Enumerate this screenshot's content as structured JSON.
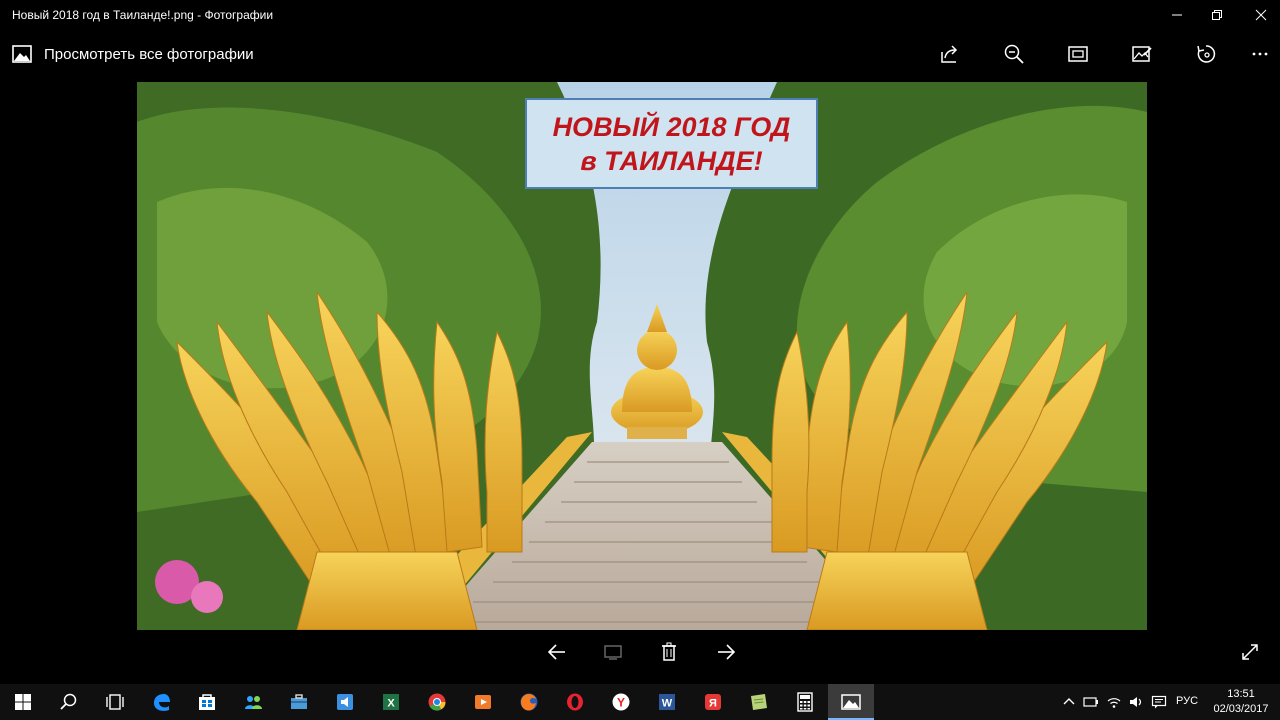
{
  "window": {
    "title": "Новый 2018 год в Таиланде!.png - Фотографии"
  },
  "appbar": {
    "view_all_label": "Просмотреть все фотографии"
  },
  "photo": {
    "caption_line1": "НОВЫЙ 2018  ГОД",
    "caption_line2": "в ТАИЛАНДЕ!",
    "caption_color": "#c0161b",
    "caption_bg": "#cfe3f0"
  },
  "icons": {
    "toolbar": [
      "share-icon",
      "zoom-out-icon",
      "slideshow-icon",
      "edit-icon",
      "rotate-icon",
      "more-icon"
    ],
    "nav": [
      "arrow-left-icon",
      "cast-icon",
      "delete-icon",
      "arrow-right-icon",
      "fullscreen-icon"
    ]
  },
  "taskbar": {
    "language": "РУС",
    "time": "13:51",
    "date": "02/03/2017",
    "apps": [
      "start",
      "search",
      "task-view",
      "edge",
      "store",
      "people",
      "briefcase",
      "audio",
      "excel",
      "chrome",
      "media-player",
      "firefox",
      "opera",
      "yandex",
      "word",
      "yandex-browser",
      "notes",
      "calculator",
      "photos"
    ]
  },
  "colors": {
    "background": "#000000",
    "taskbar": "#101010",
    "accent": "#7ab6ff"
  }
}
